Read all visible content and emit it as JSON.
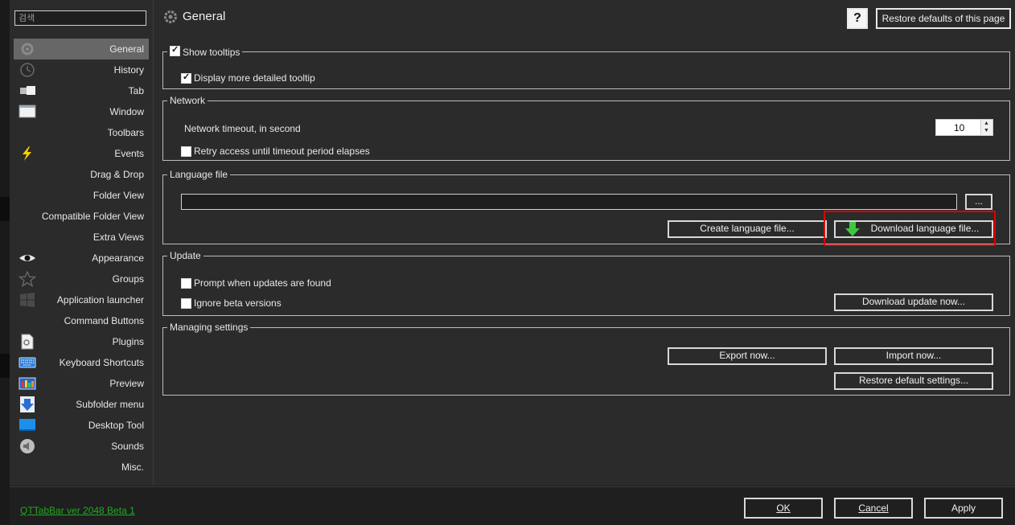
{
  "search": {
    "placeholder": "검색"
  },
  "sidebar": {
    "items": [
      {
        "label": "General",
        "icon": "gear-icon",
        "selected": true
      },
      {
        "label": "History",
        "icon": "clock-icon"
      },
      {
        "label": "Tab",
        "icon": "tab-icon"
      },
      {
        "label": "Window",
        "icon": "window-icon"
      },
      {
        "label": "Toolbars",
        "icon": ""
      },
      {
        "label": "Events",
        "icon": "lightning-icon"
      },
      {
        "label": "Drag & Drop",
        "icon": ""
      },
      {
        "label": "Folder View",
        "icon": ""
      },
      {
        "label": "Compatible Folder View",
        "icon": ""
      },
      {
        "label": "Extra Views",
        "icon": ""
      },
      {
        "label": "Appearance",
        "icon": "eye-icon"
      },
      {
        "label": "Groups",
        "icon": "star-icon"
      },
      {
        "label": "Application launcher",
        "icon": "windows-logo-icon"
      },
      {
        "label": "Command Buttons",
        "icon": ""
      },
      {
        "label": "Plugins",
        "icon": "plugin-icon"
      },
      {
        "label": "Keyboard Shortcuts",
        "icon": "keyboard-icon"
      },
      {
        "label": "Preview",
        "icon": "image-icon"
      },
      {
        "label": "Subfolder menu",
        "icon": "arrow-down-icon"
      },
      {
        "label": "Desktop Tool",
        "icon": "desktop-icon"
      },
      {
        "label": "Sounds",
        "icon": "speaker-icon"
      },
      {
        "label": "Misc.",
        "icon": ""
      }
    ]
  },
  "header": {
    "title": "General",
    "help_label": "?",
    "restore_page_label": "Restore defaults of this page"
  },
  "tooltips": {
    "show_label": "Show tooltips",
    "show_checked": true,
    "detailed_label": "Display more detailed tooltip",
    "detailed_checked": true
  },
  "network": {
    "legend": "Network",
    "timeout_label": "Network timeout, in second",
    "timeout_value": "10",
    "retry_label": "Retry access until timeout period elapses",
    "retry_checked": false
  },
  "language": {
    "legend": "Language file",
    "path_value": "",
    "browse_label": "...",
    "create_label": "Create language file...",
    "download_label": "Download language file..."
  },
  "update": {
    "legend": "Update",
    "prompt_label": "Prompt when updates are found",
    "prompt_checked": false,
    "ignore_beta_label": "Ignore beta versions",
    "ignore_beta_checked": false,
    "download_now_label": "Download update now..."
  },
  "managing": {
    "legend": "Managing settings",
    "export_label": "Export now...",
    "import_label": "Import now...",
    "restore_default_label": "Restore default settings..."
  },
  "footer": {
    "version": "QTTabBar ver 2048 Beta 1",
    "ok_label": "OK",
    "cancel_label": "Cancel",
    "apply_label": "Apply"
  },
  "colors": {
    "highlight": "#e00000",
    "version_link": "#22aa22",
    "selected_item": "#676767"
  }
}
